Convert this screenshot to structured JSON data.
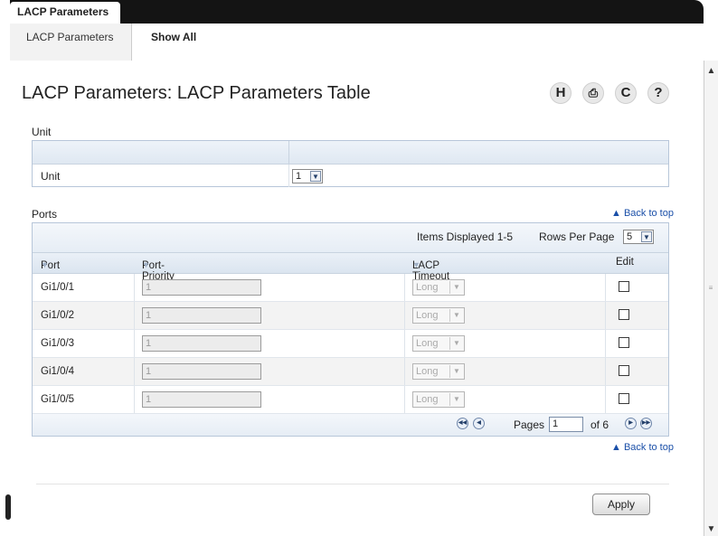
{
  "tabs": {
    "active": "LACP Parameters"
  },
  "subnav": {
    "items": [
      {
        "label": "LACP Parameters"
      },
      {
        "label": "Show All"
      }
    ]
  },
  "page": {
    "title": "LACP Parameters: LACP Parameters Table"
  },
  "toolbar": {
    "icons": [
      "save-icon",
      "print-icon",
      "refresh-icon",
      "help-icon"
    ],
    "save": "H",
    "refresh": "C",
    "help": "?"
  },
  "unit_section": {
    "label": "Unit",
    "row_label": "Unit",
    "selected": "1"
  },
  "ports_section": {
    "label": "Ports",
    "back_to_top": "▲ Back to top",
    "items_displayed": "Items Displayed 1-5",
    "rows_per_page_label": "Rows Per Page",
    "rows_per_page": "5",
    "columns": {
      "port": "Port",
      "priority": "Port-Priority",
      "timeout": "LACP Timeout",
      "edit": "Edit"
    },
    "rows": [
      {
        "port": "Gi1/0/1",
        "priority": "1",
        "timeout": "Long"
      },
      {
        "port": "Gi1/0/2",
        "priority": "1",
        "timeout": "Long"
      },
      {
        "port": "Gi1/0/3",
        "priority": "1",
        "timeout": "Long"
      },
      {
        "port": "Gi1/0/4",
        "priority": "1",
        "timeout": "Long"
      },
      {
        "port": "Gi1/0/5",
        "priority": "1",
        "timeout": "Long"
      }
    ],
    "pager": {
      "pages_label": "Pages",
      "current": "1",
      "of": "of 6"
    }
  },
  "bottom_back_to_top": "▲ Back to top",
  "apply_label": "Apply",
  "colors": {
    "header_bar": "#141414",
    "link": "#1a4fa8",
    "table_border": "#b7c6d9"
  }
}
